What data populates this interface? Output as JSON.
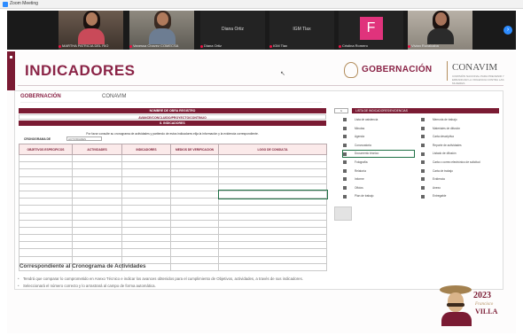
{
  "window": {
    "title": "Zoom Meeting"
  },
  "participants": [
    {
      "name": "MARTHA PATRICIA DEL RIO"
    },
    {
      "name": "Vanessa Chavez COMECSA"
    },
    {
      "name": "Diana Ortiz"
    },
    {
      "name": "IGM Tlax"
    },
    {
      "name": "Cristina Romero",
      "avatar_letter": "F"
    },
    {
      "name": "Vivian Ruvalcaba"
    }
  ],
  "slide": {
    "title": "INDICADORES",
    "logos": {
      "gobernacion": "GOBERNACIÓN",
      "conavim": "CONAVIM",
      "conavim_sub": "COMISIÓN NACIONAL PARA PREVENIR Y ERRADICAR LA VIOLENCIA CONTRA LAS MUJERES"
    },
    "accent_color": "#7a1b33",
    "excel": {
      "mini_logos": {
        "gobernacion": "GOBERNACIÓN",
        "conavim": "CONAVIM"
      },
      "bar1": "NOMBRE DE OBRA REGISTRO",
      "bar2": "AVANCE/CONCLUIDO/PROYECTO/CONTINUO",
      "bar3": "8. INDICADORES",
      "note": "Por favor consulte su cronograma de actividades y partiendo de estos indicadores elija la información y la evidencia correspondiente.",
      "crono_label": "CRONOGRAMA DE",
      "crono_value": "ACTIVIDADES",
      "columns": [
        "OBJETIVOS ESPECIFICOS",
        "ACTIVIDADES",
        "INDICADORES",
        "MEDIOS DE VERIFICACION",
        "LOGO DE CONSULTA"
      ],
      "side_header_num": "1",
      "side_header": "LISTA DE INDICADORES/EVIDENCIAS",
      "options_left": [
        "Lista de asistencia",
        "Minutas",
        "Agenda",
        "Convocatoria",
        "Documento técnico",
        "Fotografía",
        "Relatoría",
        "Informe",
        "Oficios",
        "Plan de trabajo"
      ],
      "options_right": [
        "Memoria de trabajo",
        "Materiales de difusión",
        "Carta descriptiva",
        "Reporte de actividades",
        "Listado de difusión",
        "Carta o correo electrónico de solicitud",
        "Carta de trabajo",
        "Evidencia",
        "Anexo",
        "Entregable"
      ]
    },
    "section_title": "Correspondiente al Cronograma de Actividades",
    "bullets": [
      "Tendrá que comparar lo comprometido en Anexo Técnico e indicar los avances obtenidos para el cumplimiento de Objetivos, actividades, a través de sus indicadores.",
      "Seleccionará el número correcto y lo arrastrará al campo de forma automática."
    ],
    "villa": {
      "year": "2023",
      "line1": "Francisco",
      "line2": "VILLA"
    }
  }
}
